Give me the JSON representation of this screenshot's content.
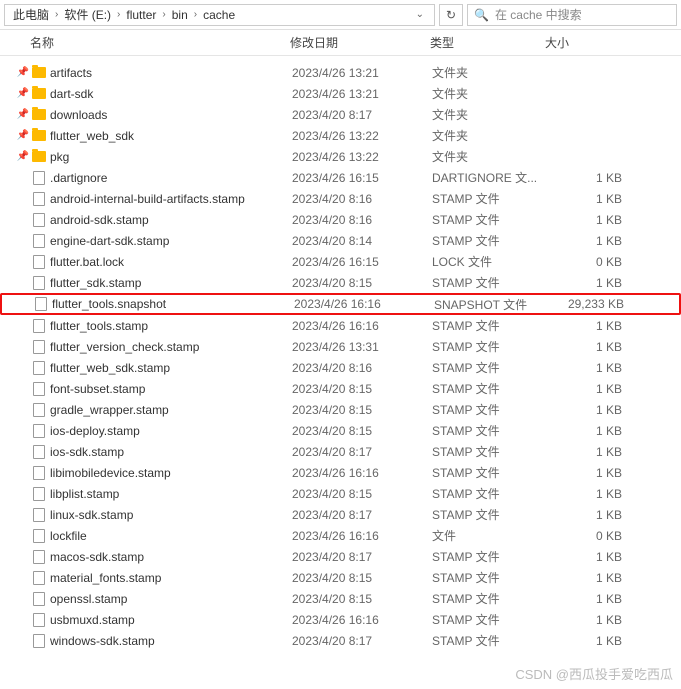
{
  "breadcrumb": {
    "items": [
      "此电脑",
      "软件 (E:)",
      "flutter",
      "bin",
      "cache"
    ]
  },
  "search": {
    "placeholder": "在 cache 中搜索"
  },
  "columns": {
    "name": "名称",
    "date": "修改日期",
    "type": "类型",
    "size": "大小"
  },
  "files": [
    {
      "pin": true,
      "icon": "folder",
      "name": "artifacts",
      "date": "2023/4/26 13:21",
      "type": "文件夹",
      "size": "",
      "hl": false
    },
    {
      "pin": true,
      "icon": "folder",
      "name": "dart-sdk",
      "date": "2023/4/26 13:21",
      "type": "文件夹",
      "size": "",
      "hl": false
    },
    {
      "pin": true,
      "icon": "folder",
      "name": "downloads",
      "date": "2023/4/20 8:17",
      "type": "文件夹",
      "size": "",
      "hl": false
    },
    {
      "pin": true,
      "icon": "folder",
      "name": "flutter_web_sdk",
      "date": "2023/4/26 13:22",
      "type": "文件夹",
      "size": "",
      "hl": false
    },
    {
      "pin": true,
      "icon": "folder",
      "name": "pkg",
      "date": "2023/4/26 13:22",
      "type": "文件夹",
      "size": "",
      "hl": false
    },
    {
      "pin": false,
      "icon": "file",
      "name": ".dartignore",
      "date": "2023/4/26 16:15",
      "type": "DARTIGNORE 文...",
      "size": "1 KB",
      "hl": false
    },
    {
      "pin": false,
      "icon": "file",
      "name": "android-internal-build-artifacts.stamp",
      "date": "2023/4/20 8:16",
      "type": "STAMP 文件",
      "size": "1 KB",
      "hl": false
    },
    {
      "pin": false,
      "icon": "file",
      "name": "android-sdk.stamp",
      "date": "2023/4/20 8:16",
      "type": "STAMP 文件",
      "size": "1 KB",
      "hl": false
    },
    {
      "pin": false,
      "icon": "file",
      "name": "engine-dart-sdk.stamp",
      "date": "2023/4/20 8:14",
      "type": "STAMP 文件",
      "size": "1 KB",
      "hl": false
    },
    {
      "pin": false,
      "icon": "file",
      "name": "flutter.bat.lock",
      "date": "2023/4/26 16:15",
      "type": "LOCK 文件",
      "size": "0 KB",
      "hl": false
    },
    {
      "pin": false,
      "icon": "file",
      "name": "flutter_sdk.stamp",
      "date": "2023/4/20 8:15",
      "type": "STAMP 文件",
      "size": "1 KB",
      "hl": false
    },
    {
      "pin": false,
      "icon": "file",
      "name": "flutter_tools.snapshot",
      "date": "2023/4/26 16:16",
      "type": "SNAPSHOT 文件",
      "size": "29,233 KB",
      "hl": true
    },
    {
      "pin": false,
      "icon": "file",
      "name": "flutter_tools.stamp",
      "date": "2023/4/26 16:16",
      "type": "STAMP 文件",
      "size": "1 KB",
      "hl": false
    },
    {
      "pin": false,
      "icon": "file",
      "name": "flutter_version_check.stamp",
      "date": "2023/4/26 13:31",
      "type": "STAMP 文件",
      "size": "1 KB",
      "hl": false
    },
    {
      "pin": false,
      "icon": "file",
      "name": "flutter_web_sdk.stamp",
      "date": "2023/4/20 8:16",
      "type": "STAMP 文件",
      "size": "1 KB",
      "hl": false
    },
    {
      "pin": false,
      "icon": "file",
      "name": "font-subset.stamp",
      "date": "2023/4/20 8:15",
      "type": "STAMP 文件",
      "size": "1 KB",
      "hl": false
    },
    {
      "pin": false,
      "icon": "file",
      "name": "gradle_wrapper.stamp",
      "date": "2023/4/20 8:15",
      "type": "STAMP 文件",
      "size": "1 KB",
      "hl": false
    },
    {
      "pin": false,
      "icon": "file",
      "name": "ios-deploy.stamp",
      "date": "2023/4/20 8:15",
      "type": "STAMP 文件",
      "size": "1 KB",
      "hl": false
    },
    {
      "pin": false,
      "icon": "file",
      "name": "ios-sdk.stamp",
      "date": "2023/4/20 8:17",
      "type": "STAMP 文件",
      "size": "1 KB",
      "hl": false
    },
    {
      "pin": false,
      "icon": "file",
      "name": "libimobiledevice.stamp",
      "date": "2023/4/26 16:16",
      "type": "STAMP 文件",
      "size": "1 KB",
      "hl": false
    },
    {
      "pin": false,
      "icon": "file",
      "name": "libplist.stamp",
      "date": "2023/4/20 8:15",
      "type": "STAMP 文件",
      "size": "1 KB",
      "hl": false
    },
    {
      "pin": false,
      "icon": "file",
      "name": "linux-sdk.stamp",
      "date": "2023/4/20 8:17",
      "type": "STAMP 文件",
      "size": "1 KB",
      "hl": false
    },
    {
      "pin": false,
      "icon": "file",
      "name": "lockfile",
      "date": "2023/4/26 16:16",
      "type": "文件",
      "size": "0 KB",
      "hl": false
    },
    {
      "pin": false,
      "icon": "file",
      "name": "macos-sdk.stamp",
      "date": "2023/4/20 8:17",
      "type": "STAMP 文件",
      "size": "1 KB",
      "hl": false
    },
    {
      "pin": false,
      "icon": "file",
      "name": "material_fonts.stamp",
      "date": "2023/4/20 8:15",
      "type": "STAMP 文件",
      "size": "1 KB",
      "hl": false
    },
    {
      "pin": false,
      "icon": "file",
      "name": "openssl.stamp",
      "date": "2023/4/20 8:15",
      "type": "STAMP 文件",
      "size": "1 KB",
      "hl": false
    },
    {
      "pin": false,
      "icon": "file",
      "name": "usbmuxd.stamp",
      "date": "2023/4/26 16:16",
      "type": "STAMP 文件",
      "size": "1 KB",
      "hl": false
    },
    {
      "pin": false,
      "icon": "file",
      "name": "windows-sdk.stamp",
      "date": "2023/4/20 8:17",
      "type": "STAMP 文件",
      "size": "1 KB",
      "hl": false
    }
  ],
  "watermark": "CSDN @西瓜投手爱吃西瓜"
}
